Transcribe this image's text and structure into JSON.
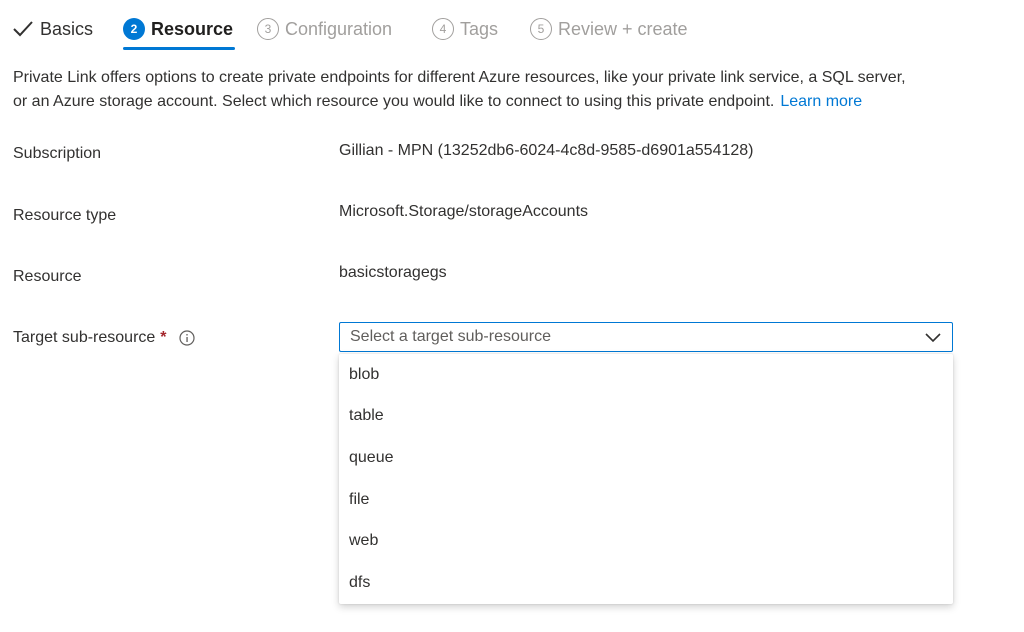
{
  "tabs": [
    {
      "label": "Basics",
      "state": "done"
    },
    {
      "step": "2",
      "label": "Resource",
      "state": "active"
    },
    {
      "step": "3",
      "label": "Configuration",
      "state": "disabled"
    },
    {
      "step": "4",
      "label": "Tags",
      "state": "disabled"
    },
    {
      "step": "5",
      "label": "Review + create",
      "state": "disabled"
    }
  ],
  "description": {
    "line1": "Private Link offers options to create private endpoints for different Azure resources, like your private link service, a SQL server,",
    "line2": "or an Azure storage account. Select which resource you would like to connect to using this private endpoint.",
    "learn_more": "Learn more"
  },
  "form": {
    "subscription": {
      "label": "Subscription",
      "value": "Gillian - MPN (13252db6-6024-4c8d-9585-d6901a554128)"
    },
    "resource_type": {
      "label": "Resource type",
      "value": "Microsoft.Storage/storageAccounts"
    },
    "resource": {
      "label": "Resource",
      "value": "basicstoragegs"
    },
    "target_sub_resource": {
      "label": "Target sub-resource",
      "required_mark": "*",
      "placeholder": "Select a target sub-resource",
      "options": [
        "blob",
        "table",
        "queue",
        "file",
        "web",
        "dfs"
      ]
    }
  },
  "icons": {
    "done": "checkmark-icon",
    "info": "info-icon",
    "dropdown": "chevron-down-icon"
  },
  "colors": {
    "accent": "#0078d4",
    "required": "#a4262c",
    "disabled": "#a19f9d"
  }
}
